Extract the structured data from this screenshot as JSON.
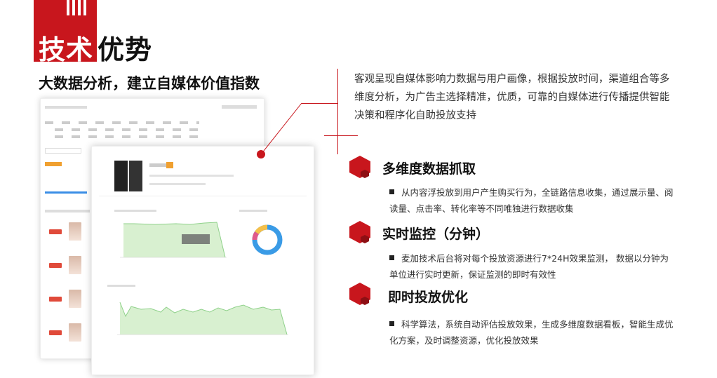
{
  "title": {
    "part1": "技术",
    "part2": "优势"
  },
  "subtitle": "大数据分析，建立自媒体价值指数",
  "description": "客观呈现自媒体影响力数据与用户画像，根据投放时间，渠道组合等多维度分析，为广告主选择精准，优质，可靠的自媒体进行传播提供智能决策和程序化自助投放支持",
  "features": [
    {
      "title": "多维度数据抓取",
      "bullet": "从内容浮投放到用户产生购买行为，全链路信息收集，通过展示量、阅读量、点击率、转化率等不同唯独进行数据收集"
    },
    {
      "title": "实时监控（分钟）",
      "bullet": "麦加技术后台将对每个投放资源进行7*24H效果监测， 数据以分钟为单位进行实时更新，保证监测的即时有效性"
    },
    {
      "title": "即时投放优化",
      "bullet": "科学算法，系统自动评估投放效果，生成多维度数据看板，智能生成优化方案，及时调整资源，优化投放效果"
    }
  ],
  "colors": {
    "accent": "#c8161d",
    "chart_green": "#8fd18a",
    "chart_fill": "#d8f0d0",
    "donut_blue": "#3a9be6"
  }
}
